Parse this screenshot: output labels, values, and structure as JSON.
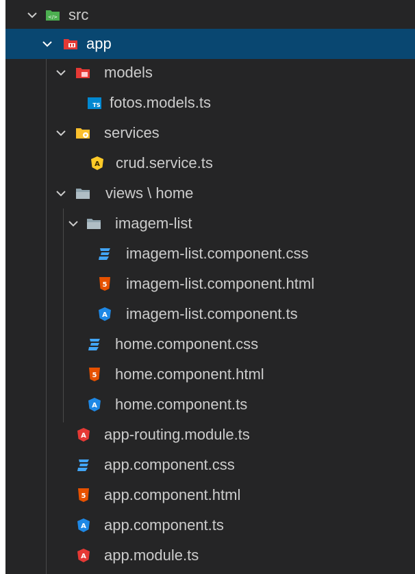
{
  "colors": {
    "panel_background": "#252526",
    "selection_background": "#094771",
    "text": "#cccccc",
    "css_icon": "#42a5f5",
    "html_icon": "#e65100",
    "angular_ts_icon": "#1e88e5",
    "angular_service_icon": "#ffca28",
    "angular_module_icon": "#e53935",
    "ts_icon": "#0288d1"
  },
  "tree": [
    {
      "label": "src",
      "kind": "folder",
      "icon": "src-folder-icon",
      "expanded": true
    },
    {
      "label": "app",
      "kind": "folder",
      "icon": "app-folder-icon",
      "expanded": true,
      "selected": true
    },
    {
      "label": "models",
      "kind": "folder",
      "icon": "models-folder-icon",
      "expanded": true
    },
    {
      "label": "fotos.models.ts",
      "kind": "file",
      "icon": "typescript-file-icon"
    },
    {
      "label": "services",
      "kind": "folder",
      "icon": "services-folder-icon",
      "expanded": true
    },
    {
      "label": "crud.service.ts",
      "kind": "file",
      "icon": "angular-service-icon"
    },
    {
      "label": "views \\ home",
      "kind": "folder",
      "icon": "views-folder-icon",
      "expanded": true
    },
    {
      "label": "imagem-list",
      "kind": "folder",
      "icon": "imagem-list-folder-icon",
      "expanded": true
    },
    {
      "label": "imagem-list.component.css",
      "kind": "file",
      "icon": "css-file-icon"
    },
    {
      "label": "imagem-list.component.html",
      "kind": "file",
      "icon": "html-file-icon"
    },
    {
      "label": "imagem-list.component.ts",
      "kind": "file",
      "icon": "angular-component-icon"
    },
    {
      "label": "home.component.css",
      "kind": "file",
      "icon": "css-file-icon"
    },
    {
      "label": "home.component.html",
      "kind": "file",
      "icon": "html-file-icon"
    },
    {
      "label": "home.component.ts",
      "kind": "file",
      "icon": "angular-component-icon"
    },
    {
      "label": "app-routing.module.ts",
      "kind": "file",
      "icon": "angular-module-icon"
    },
    {
      "label": "app.component.css",
      "kind": "file",
      "icon": "css-file-icon"
    },
    {
      "label": "app.component.html",
      "kind": "file",
      "icon": "html-file-icon"
    },
    {
      "label": "app.component.ts",
      "kind": "file",
      "icon": "angular-component-icon"
    },
    {
      "label": "app.module.ts",
      "kind": "file",
      "icon": "angular-module-icon"
    }
  ]
}
